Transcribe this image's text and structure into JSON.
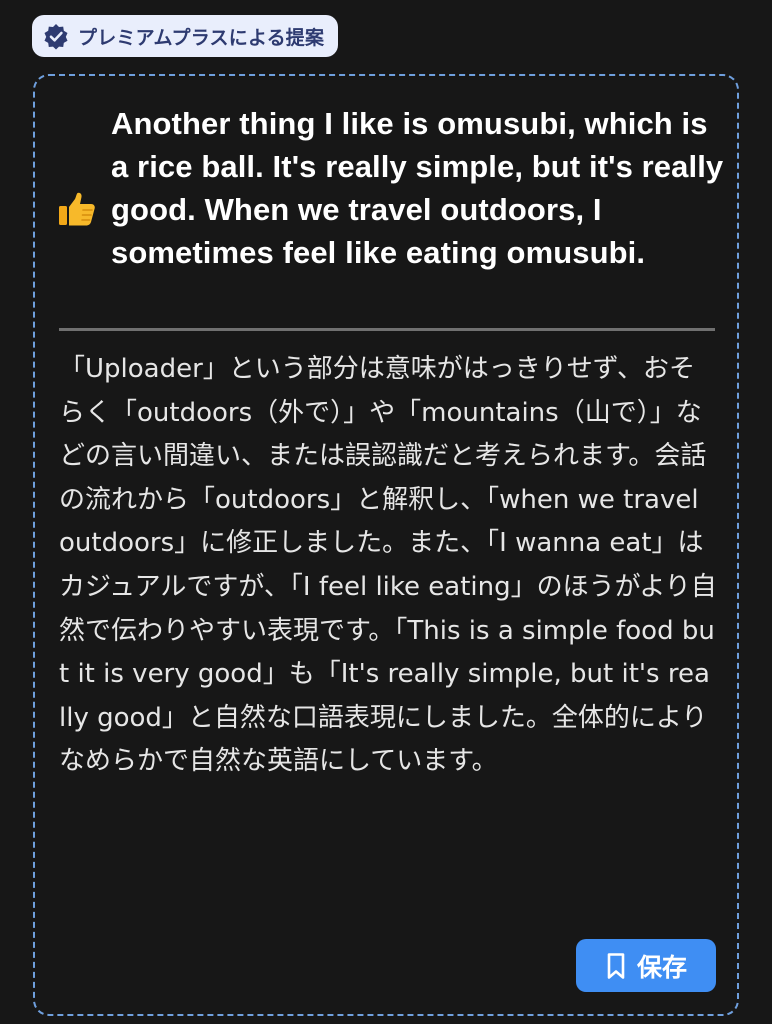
{
  "badge": {
    "icon": "verified-badge-icon",
    "label": "プレミアムプラスによる提案"
  },
  "card": {
    "reaction_icon": "thumbs-up-icon",
    "suggestion_text": "Another thing I like is omusubi, which is a rice ball. It's really simple, but it's really good. When we travel outdoors, I sometimes feel like eating omusubi.",
    "explanation_text": "「Uploader」という部分は意味がはっきりせず、おそらく「outdoors（外で）」や「mountains（山で）」などの言い間違い、または誤認識だと考えられます。会話の流れから「outdoors」と解釈し、「when we travel outdoors」に修正しました。また、「I wanna eat」はカジュアルですが、「I feel like eating」のほうがより自然で伝わりやすい表現です。「This is a simple food but it is very good」も「It's really simple, but it's really good」と自然な口語表現にしました。全体的によりなめらかで自然な英語にしています。",
    "save_button": {
      "icon": "bookmark-icon",
      "label": "保存"
    }
  },
  "colors": {
    "background": "#171717",
    "badge_background": "#e9eefc",
    "badge_text": "#2e3b71",
    "card_border": "#6f9fdd",
    "divider": "#707070",
    "save_button": "#3f8ef3"
  }
}
